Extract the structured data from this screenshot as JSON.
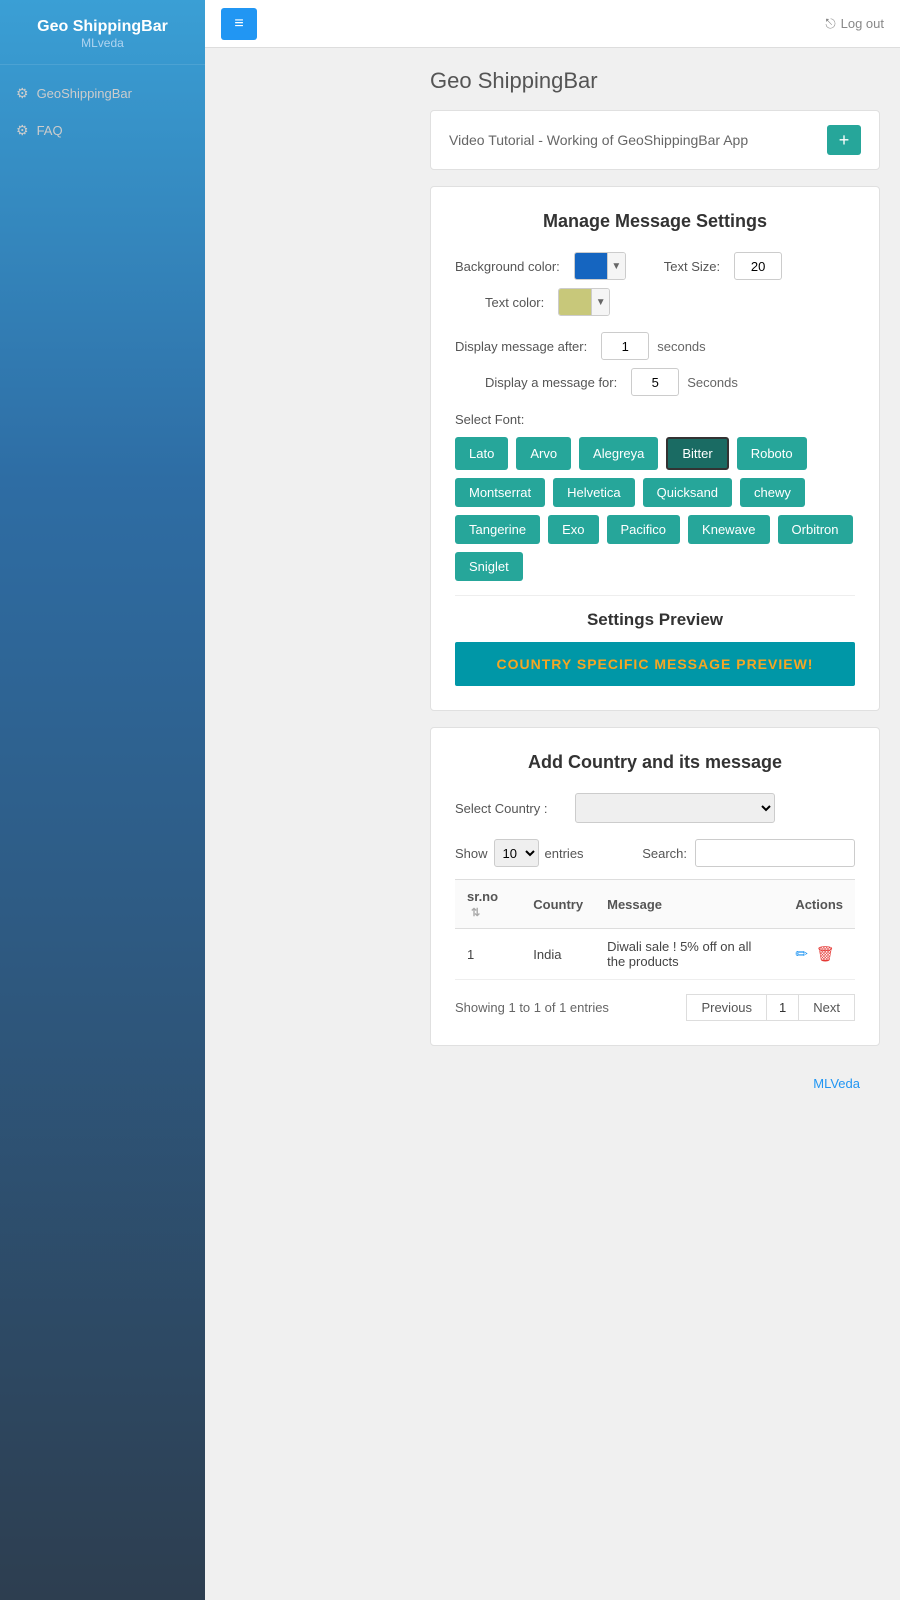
{
  "sidebar": {
    "app_title": "Geo ShippingBar",
    "app_subtitle": "MLveda",
    "nav_items": [
      {
        "id": "geo-shippingbar",
        "label": "GeoShippingBar",
        "icon": "⚙"
      },
      {
        "id": "faq",
        "label": "FAQ",
        "icon": "⚙"
      }
    ]
  },
  "topbar": {
    "menu_icon": "≡",
    "logout_label": "Log out",
    "logout_icon": "⎋"
  },
  "page": {
    "title": "Geo ShippingBar"
  },
  "video_tutorial": {
    "label": "Video Tutorial - Working of GeoShippingBar App",
    "button_icon": "+"
  },
  "manage_message": {
    "title": "Manage Message Settings",
    "bg_color_label": "Background color:",
    "bg_color_value": "#1565C0",
    "text_size_label": "Text Size:",
    "text_size_value": "20",
    "text_color_label": "Text color:",
    "text_color_value": "#c8c87a",
    "display_after_label": "Display message after:",
    "display_after_value": "1",
    "display_after_unit": "seconds",
    "display_for_label": "Display a message for:",
    "display_for_value": "5",
    "display_for_unit": "Seconds",
    "select_font_label": "Select Font:",
    "fonts": [
      {
        "id": "lato",
        "label": "Lato",
        "active": false
      },
      {
        "id": "arvo",
        "label": "Arvo",
        "active": false
      },
      {
        "id": "alegreya",
        "label": "Alegreya",
        "active": false
      },
      {
        "id": "bitter",
        "label": "Bitter",
        "active": true
      },
      {
        "id": "roboto",
        "label": "Roboto",
        "active": false
      },
      {
        "id": "montserrat",
        "label": "Montserrat",
        "active": false
      },
      {
        "id": "helvetica",
        "label": "Helvetica",
        "active": false
      },
      {
        "id": "quicksand",
        "label": "Quicksand",
        "active": false
      },
      {
        "id": "chewy",
        "label": "chewy",
        "active": false
      },
      {
        "id": "tangerine",
        "label": "Tangerine",
        "active": false
      },
      {
        "id": "exo",
        "label": "Exo",
        "active": false
      },
      {
        "id": "pacifico",
        "label": "Pacifico",
        "active": false
      },
      {
        "id": "knewave",
        "label": "Knewave",
        "active": false
      },
      {
        "id": "orbitron",
        "label": "Orbitron",
        "active": false
      },
      {
        "id": "sniglet",
        "label": "Sniglet",
        "active": false
      }
    ]
  },
  "settings_preview": {
    "title": "Settings Preview",
    "preview_text": "COUNTRY SPECIFIC MESSAGE PREVIEW!"
  },
  "add_country": {
    "title": "Add Country and its message",
    "select_country_label": "Select Country :",
    "show_label": "Show",
    "entries_value": "10",
    "entries_label": "entries",
    "search_label": "Search:",
    "table": {
      "headers": [
        "sr.no",
        "Country",
        "Message",
        "Actions"
      ],
      "rows": [
        {
          "srno": "1",
          "country": "India",
          "message": "Diwali sale ! 5% off on all the products"
        }
      ]
    },
    "pagination": {
      "showing_text": "Showing 1 to 1 of 1 entries",
      "previous_label": "Previous",
      "page_number": "1",
      "next_label": "Next"
    }
  },
  "footer": {
    "brand": "MLVeda"
  }
}
